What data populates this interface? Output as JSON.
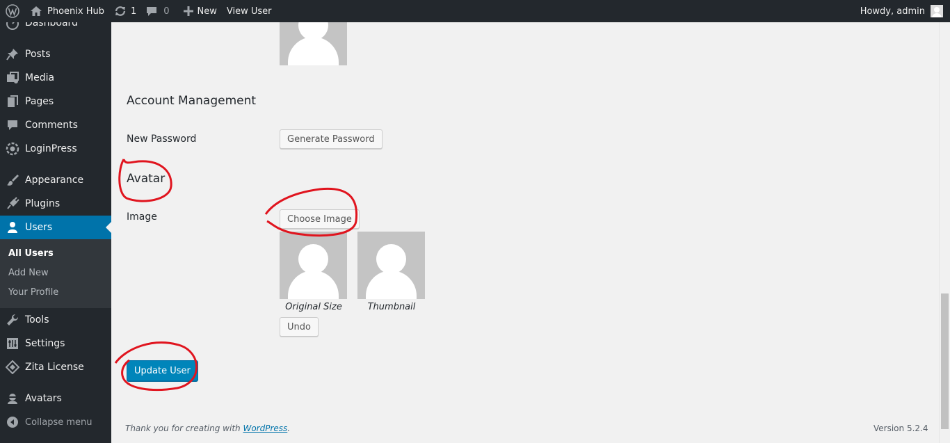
{
  "adminbar": {
    "site_name": "Phoenix Hub",
    "updates_count": "1",
    "comments_count": "0",
    "new_label": "New",
    "view_user_label": "View User",
    "howdy": "Howdy, admin"
  },
  "sidebar": {
    "items": {
      "dashboard": "Dashboard",
      "posts": "Posts",
      "media": "Media",
      "pages": "Pages",
      "comments": "Comments",
      "loginpress": "LoginPress",
      "appearance": "Appearance",
      "plugins": "Plugins",
      "users": "Users",
      "tools": "Tools",
      "settings": "Settings",
      "zita_license": "Zita License",
      "avatars": "Avatars",
      "collapse": "Collapse menu"
    },
    "users_submenu": {
      "all_users": "All Users",
      "add_new": "Add New",
      "your_profile": "Your Profile"
    },
    "accent": "#0073aa"
  },
  "main": {
    "account_management_title": "Account Management",
    "new_password_label": "New Password",
    "generate_password_button": "Generate Password",
    "avatar_title": "Avatar",
    "image_label": "Image",
    "choose_image_button": "Choose Image",
    "original_size_caption": "Original Size",
    "thumbnail_caption": "Thumbnail",
    "undo_button": "Undo",
    "update_user_button": "Update User"
  },
  "footer": {
    "thanks_prefix": "Thank you for creating with ",
    "wordpress_link": "WordPress",
    "thanks_suffix": ".",
    "version": "Version 5.2.4"
  },
  "annotation_color": "#e0141e"
}
